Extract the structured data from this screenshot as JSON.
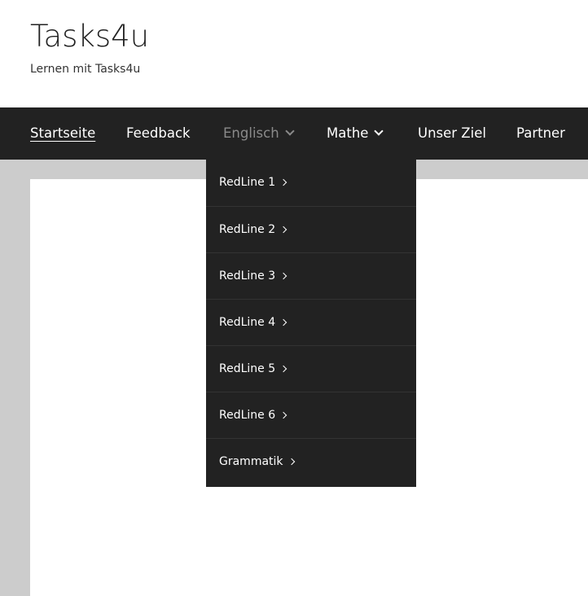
{
  "site": {
    "title": "Tasks4u",
    "tagline": "Lernen mit Tasks4u"
  },
  "nav": {
    "items": [
      {
        "label": "Startseite"
      },
      {
        "label": "Feedback"
      },
      {
        "label": "Englisch"
      },
      {
        "label": "Mathe"
      },
      {
        "label": "Unser Ziel"
      },
      {
        "label": "Partner"
      }
    ]
  },
  "dropdown": {
    "items": [
      {
        "label": "RedLine 1"
      },
      {
        "label": "RedLine 2"
      },
      {
        "label": "RedLine 3"
      },
      {
        "label": "RedLine 4"
      },
      {
        "label": "RedLine 5"
      },
      {
        "label": "RedLine 6"
      },
      {
        "label": "Grammatik"
      }
    ]
  },
  "colors": {
    "navbar": "#222222",
    "dropdown": "#222222",
    "content_background": "#cccccc",
    "open_menu_text": "#8a8a8a"
  },
  "icons": {
    "submenu_down": "chevron-down-icon",
    "submenu_right": "chevron-right-icon"
  }
}
